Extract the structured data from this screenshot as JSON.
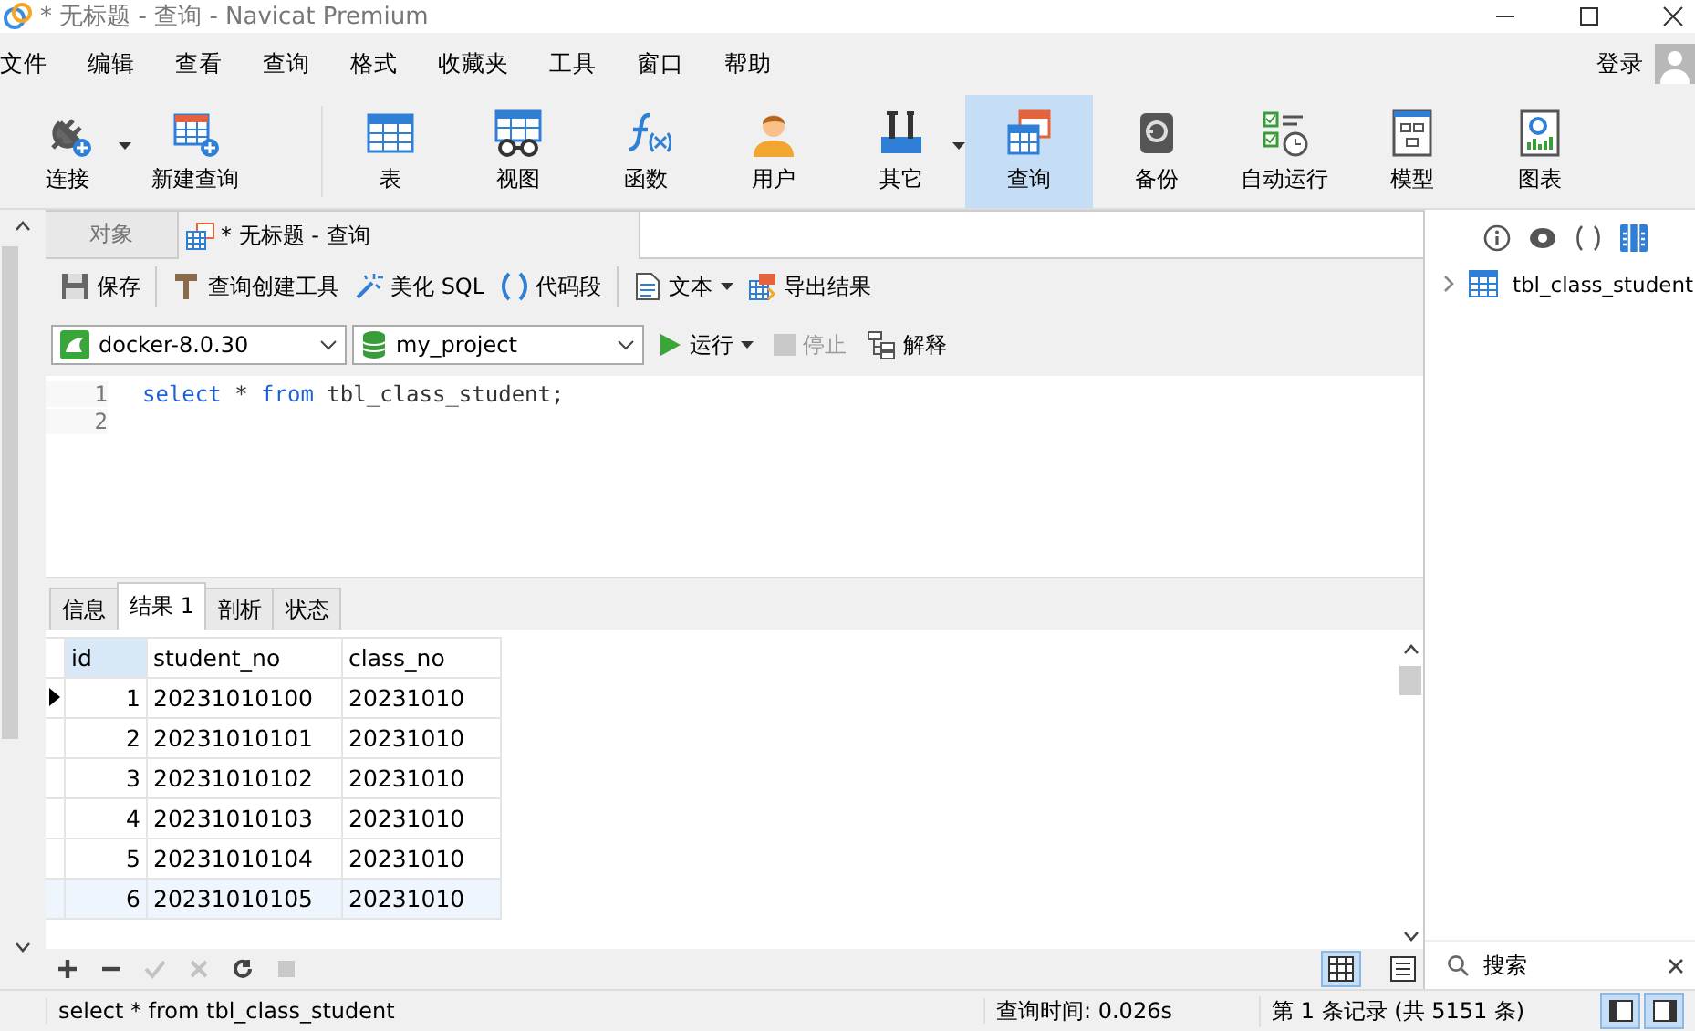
{
  "window": {
    "title": "* 无标题 - 查询 - Navicat Premium"
  },
  "menu": [
    "文件",
    "编辑",
    "查看",
    "查询",
    "格式",
    "收藏夹",
    "工具",
    "窗口",
    "帮助"
  ],
  "login": "登录",
  "toolbar": [
    {
      "label": "连接",
      "selected": false,
      "dropdown": true
    },
    {
      "label": "新建查询",
      "selected": false,
      "dropdown": false
    },
    {
      "label": "表",
      "selected": false,
      "dropdown": false
    },
    {
      "label": "视图",
      "selected": false,
      "dropdown": false
    },
    {
      "label": "函数",
      "selected": false,
      "dropdown": false
    },
    {
      "label": "用户",
      "selected": false,
      "dropdown": false
    },
    {
      "label": "其它",
      "selected": false,
      "dropdown": true
    },
    {
      "label": "查询",
      "selected": true,
      "dropdown": false
    },
    {
      "label": "备份",
      "selected": false,
      "dropdown": false
    },
    {
      "label": "自动运行",
      "selected": false,
      "dropdown": false
    },
    {
      "label": "模型",
      "selected": false,
      "dropdown": false
    },
    {
      "label": "图表",
      "selected": false,
      "dropdown": false
    }
  ],
  "object_tabs": [
    {
      "label": "对象",
      "selected": false
    },
    {
      "label": "* 无标题 - 查询",
      "selected": true
    }
  ],
  "query_toolbar": [
    [
      {
        "label": "保存",
        "dropdown": false
      }
    ],
    [
      {
        "label": "查询创建工具",
        "dropdown": false
      },
      {
        "label": "美化 SQL",
        "dropdown": false
      },
      {
        "label": "代码段",
        "dropdown": false
      }
    ],
    [
      {
        "label": "文本",
        "dropdown": true
      },
      {
        "label": "导出结果",
        "dropdown": false
      }
    ]
  ],
  "connection": {
    "value": "docker-8.0.30"
  },
  "database": {
    "value": "my_project"
  },
  "run": {
    "label": "运行",
    "disabled": false
  },
  "stop": {
    "label": "停止",
    "disabled": true
  },
  "explain": {
    "label": "解释",
    "disabled": false
  },
  "editor": {
    "lines": [
      {
        "number": "1",
        "tokens": [
          {
            "text": "select",
            "kind": "keyword"
          },
          {
            "text": " * ",
            "kind": "plain"
          },
          {
            "text": "from",
            "kind": "keyword"
          },
          {
            "text": " tbl_class_student;",
            "kind": "plain"
          }
        ]
      },
      {
        "number": "2"
      }
    ]
  },
  "result_tabs": [
    {
      "label": "信息",
      "selected": false
    },
    {
      "label": "结果 1",
      "selected": true
    },
    {
      "label": "剖析",
      "selected": false
    },
    {
      "label": "状态",
      "selected": false
    }
  ],
  "grid": {
    "columns": [
      {
        "label": "id",
        "selected": true
      },
      {
        "label": "student_no",
        "selected": false
      },
      {
        "label": "class_no",
        "selected": false
      }
    ],
    "rows": [
      {
        "cells": [
          "1",
          "20231010100",
          "20231010"
        ],
        "current": true,
        "highlighted": false
      },
      {
        "cells": [
          "2",
          "20231010101",
          "20231010"
        ],
        "current": false,
        "highlighted": false
      },
      {
        "cells": [
          "3",
          "20231010102",
          "20231010"
        ],
        "current": false,
        "highlighted": false
      },
      {
        "cells": [
          "4",
          "20231010103",
          "20231010"
        ],
        "current": false,
        "highlighted": false
      },
      {
        "cells": [
          "5",
          "20231010104",
          "20231010"
        ],
        "current": false,
        "highlighted": false
      },
      {
        "cells": [
          "6",
          "20231010105",
          "20231010"
        ],
        "current": false,
        "highlighted": true
      }
    ]
  },
  "grid_actions": [
    {
      "disabled": false
    },
    {
      "disabled": false
    },
    {
      "disabled": true
    },
    {
      "disabled": true
    },
    {
      "disabled": false
    },
    {
      "disabled": true
    }
  ],
  "view_modes": [
    {
      "selected": true
    },
    {
      "selected": false
    }
  ],
  "right_panel": {
    "tree": [
      {
        "label": "tbl_class_student",
        "expanded": false
      }
    ],
    "search": {
      "placeholder": "搜索"
    }
  },
  "status_bar": {
    "sql": "select * from tbl_class_student",
    "query_time": "查询时间: 0.026s",
    "record": "第 1 条记录 (共 5151 条)"
  },
  "layout_toggles": [
    {
      "selected": true
    },
    {
      "selected": true
    }
  ]
}
